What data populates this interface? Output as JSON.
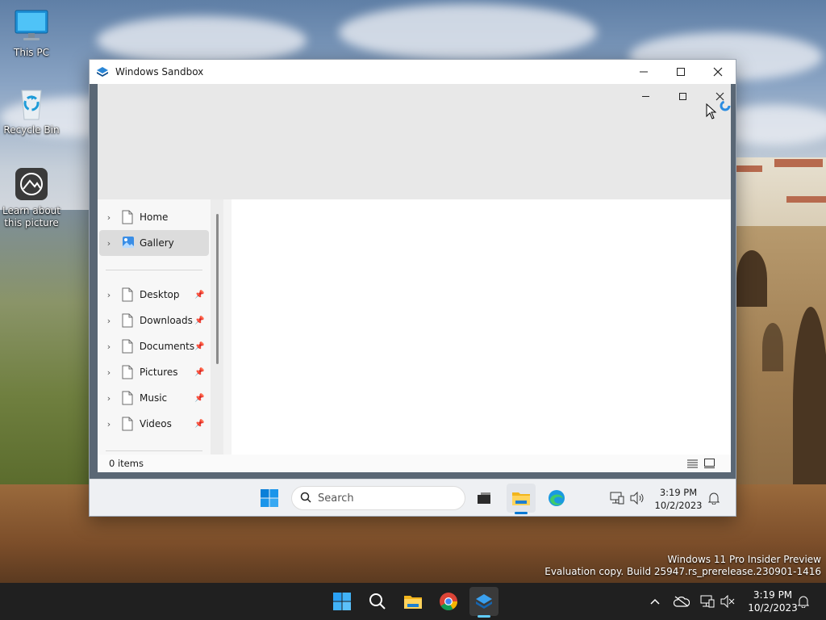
{
  "desktop": {
    "icons": [
      {
        "label": "This PC"
      },
      {
        "label": "Recycle Bin"
      },
      {
        "label": "Learn about this picture"
      }
    ],
    "watermark": {
      "line1": "Windows 11 Pro Insider Preview",
      "line2": "Evaluation copy. Build 25947.rs_prerelease.230901-1416"
    }
  },
  "sandbox_window": {
    "title": "Windows Sandbox",
    "explorer": {
      "nav_items": [
        {
          "label": "Home",
          "pinned": false,
          "selected": false
        },
        {
          "label": "Gallery",
          "pinned": false,
          "selected": true
        },
        {
          "label": "Desktop",
          "pinned": true,
          "selected": false
        },
        {
          "label": "Downloads",
          "pinned": true,
          "selected": false
        },
        {
          "label": "Documents",
          "pinned": true,
          "selected": false
        },
        {
          "label": "Pictures",
          "pinned": true,
          "selected": false
        },
        {
          "label": "Music",
          "pinned": true,
          "selected": false
        },
        {
          "label": "Videos",
          "pinned": true,
          "selected": false
        }
      ],
      "status_text": "0 items"
    },
    "taskbar": {
      "search_placeholder": "Search",
      "time": "3:19 PM",
      "date": "10/2/2023"
    }
  },
  "host_taskbar": {
    "time": "3:19 PM",
    "date": "10/2/2023"
  },
  "colors": {
    "accent": "#0078d4",
    "active_indicator": "#60cdff",
    "host_taskbar": "#202020"
  }
}
